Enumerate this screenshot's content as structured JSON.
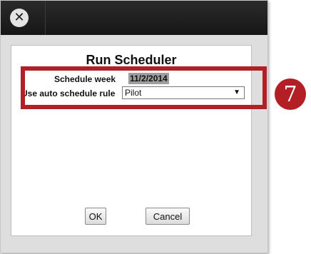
{
  "window": {
    "close_icon": "close-icon",
    "close_glyph": "✕"
  },
  "dialog": {
    "title": "Run Scheduler",
    "schedule_week_label": "Schedule week",
    "schedule_week_value": "11/2/2014",
    "auto_rule_label": "Use auto schedule rule",
    "auto_rule_selected": "Pilot",
    "auto_rule_arrow": "▼",
    "ok_label": "OK",
    "cancel_label": "Cancel"
  },
  "annotation": {
    "step_number": "7",
    "highlight_color": "#b21f24"
  }
}
